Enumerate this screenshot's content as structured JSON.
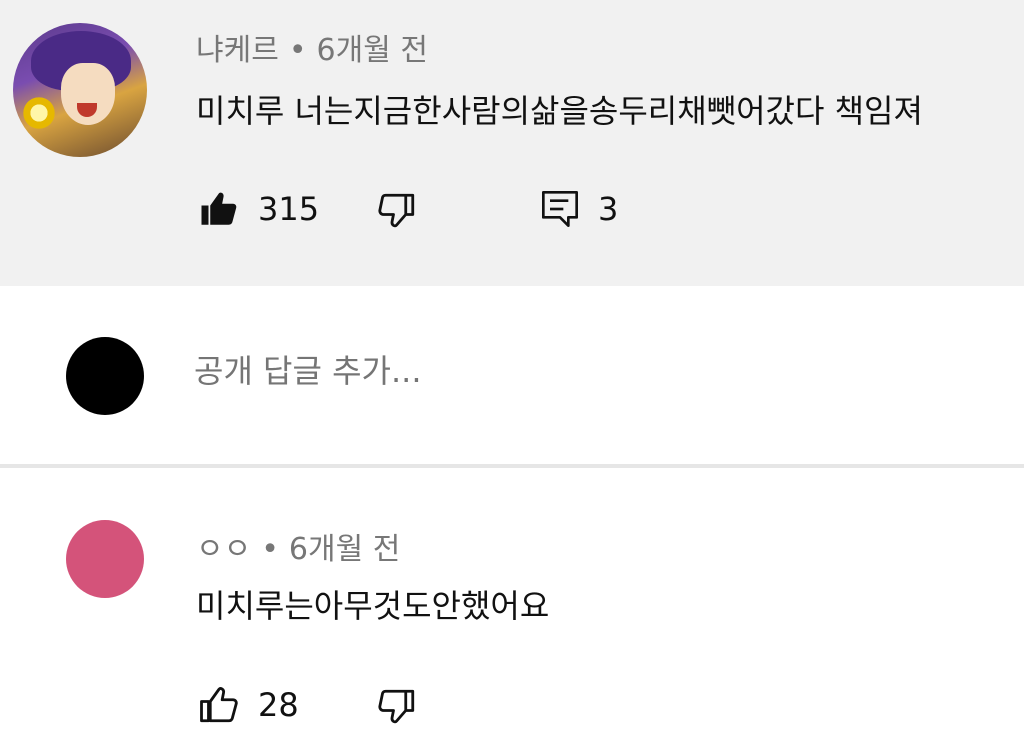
{
  "comments": [
    {
      "author": "냐케르",
      "time": "6개월 전",
      "text": "미치루 너는지금한사람의삶을송두리채뺏어갔다 책임져",
      "likes": "315",
      "replies": "3",
      "liked": true
    },
    {
      "author": "ㅇㅇ",
      "time": "6개월 전",
      "text": "미치루는아무것도안했어요",
      "likes": "28",
      "liked": false
    }
  ],
  "reply_box": {
    "placeholder": "공개 답글 추가..."
  },
  "separator": "•",
  "colors": {
    "highlight_bg": "#f1f1f1",
    "meta_text": "#777777",
    "pink_avatar": "#d4537a",
    "black_avatar": "#000000"
  },
  "icons": [
    "thumbs-up-filled-icon",
    "thumbs-down-icon",
    "reply-icon",
    "thumbs-up-icon"
  ]
}
